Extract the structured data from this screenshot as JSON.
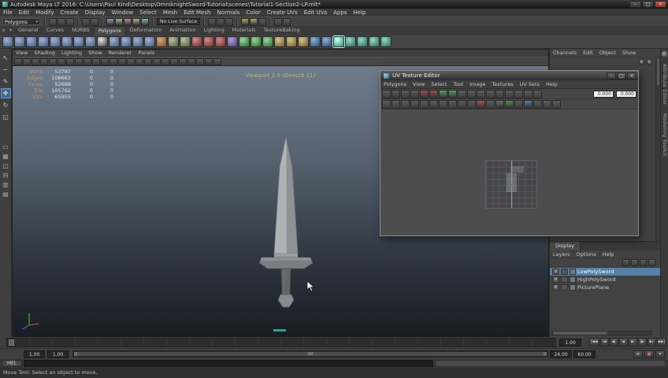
{
  "colors": {
    "selection_blue": "#5580a8",
    "viewport_top": "#6e7b8b",
    "viewport_bottom": "#191d23",
    "hud_label": "#c49a66",
    "viewport_title": "#b9bd6a",
    "close_button": "#c75b50"
  },
  "title_bar": {
    "title": "Autodesk Maya LT 2016: C:\\Users\\Paul Kind\\Desktop\\OmniknightSword-Tutorial\\scenes\\Tutorial1-Section2-LP.mlt*",
    "minimize": "–",
    "maximize": "□",
    "close": "×"
  },
  "menu_bar": {
    "items": [
      "File",
      "Edit",
      "Modify",
      "Create",
      "Display",
      "Window",
      "Select",
      "Mesh",
      "Edit Mesh",
      "Normals",
      "Color",
      "Create UVs",
      "Edit UVs",
      "Apps",
      "Help"
    ]
  },
  "status_line": {
    "menu_set": "Polygons",
    "items": [
      {
        "sep": true
      },
      {
        "n": "new-scene-icon"
      },
      {
        "n": "open-scene-icon"
      },
      {
        "n": "save-scene-icon"
      },
      {
        "sep": true
      },
      {
        "n": "undo-icon"
      },
      {
        "n": "redo-icon"
      },
      {
        "sep": true
      },
      {
        "n": "snap-to-grid-icon",
        "c": "#8a97bb"
      },
      {
        "n": "snap-to-curve-icon",
        "c": "#93b98a"
      },
      {
        "n": "snap-to-point-icon",
        "c": "#bb8a8a"
      },
      {
        "n": "snap-to-view-plane-icon",
        "c": "#b9ae8a"
      },
      {
        "n": "make-live-icon",
        "c": "#8ab9b0"
      },
      {
        "sep": true
      },
      {
        "n": "live-surface-dropdown",
        "label": "No Live Surface"
      },
      {
        "sep": true
      },
      {
        "n": "construction-history-icon"
      },
      {
        "n": "selection-highlight-icon"
      },
      {
        "n": "quick-select-icon"
      },
      {
        "sep": true
      },
      {
        "n": "render-current-frame-icon",
        "c": "#b0a36a"
      },
      {
        "n": "ipr-render-icon",
        "c": "#b0a36a"
      },
      {
        "n": "render-settings-icon"
      },
      {
        "sep": true
      },
      {
        "n": "paint-effects-icon"
      },
      {
        "n": "toolbox-toggle-icon"
      }
    ]
  },
  "shelf": {
    "tabs": [
      "General",
      "Curves",
      "NURBS",
      "Polygons",
      "Deformation",
      "Animation",
      "Lighting",
      "Materials",
      "TextureBaking"
    ],
    "active_tab": "Polygons",
    "icons": [
      {
        "n": "poly-sphere-icon",
        "c1": "#9db4d6",
        "c2": "#40567a"
      },
      {
        "n": "poly-cube-icon",
        "c1": "#9db4d6",
        "c2": "#40567a"
      },
      {
        "n": "poly-cylinder-icon",
        "c1": "#9db4d6",
        "c2": "#40567a"
      },
      {
        "n": "poly-cone-icon",
        "c1": "#9db4d6",
        "c2": "#40567a"
      },
      {
        "n": "poly-torus-icon",
        "c1": "#9db4d6",
        "c2": "#40567a"
      },
      {
        "n": "poly-plane-icon",
        "c1": "#9db4d6",
        "c2": "#40567a"
      },
      {
        "n": "poly-disc-icon",
        "c1": "#9db4d6",
        "c2": "#40567a"
      },
      {
        "n": "poly-gear-icon",
        "c1": "#9db4d6",
        "c2": "#40567a"
      },
      {
        "n": "poly-soccer-ball-icon",
        "c1": "#e8e8e8",
        "c2": "#333333"
      },
      {
        "n": "poly-platonic-icon",
        "c1": "#9db4d6",
        "c2": "#40567a"
      },
      {
        "n": "poly-pyramid-icon",
        "c1": "#9db4d6",
        "c2": "#40567a"
      },
      {
        "n": "poly-pipe-icon",
        "c1": "#9db4d6",
        "c2": "#40567a"
      },
      {
        "n": "poly-helix-icon",
        "c1": "#9db4d6",
        "c2": "#40567a"
      },
      {
        "n": "sculpt-tool-icon",
        "c1": "#d6a77a",
        "c2": "#7a4e28"
      },
      {
        "n": "combine-icon",
        "c1": "#b8c4a0",
        "c2": "#4e5a38"
      },
      {
        "n": "separate-icon",
        "c1": "#b8c4a0",
        "c2": "#4e5a38"
      },
      {
        "n": "boolean-union-icon",
        "c1": "#d68a8a",
        "c2": "#6a2828"
      },
      {
        "n": "boolean-difference-icon",
        "c1": "#d68a8a",
        "c2": "#6a2828"
      },
      {
        "n": "boolean-intersect-icon",
        "c1": "#d68a8a",
        "c2": "#6a2828"
      },
      {
        "n": "smooth-icon",
        "c1": "#b0a0d6",
        "c2": "#4a3a7a"
      },
      {
        "n": "triangulate-icon",
        "c1": "#9ad69a",
        "c2": "#2a6a2a"
      },
      {
        "n": "quadrangulate-icon",
        "c1": "#9ad69a",
        "c2": "#2a6a2a"
      },
      {
        "n": "fill-hole-icon",
        "c1": "#9ad69a",
        "c2": "#2a6a2a"
      },
      {
        "n": "reduce-icon",
        "c1": "#d6c48a",
        "c2": "#6a5a28"
      },
      {
        "n": "extrude-icon",
        "c1": "#d6c48a",
        "c2": "#6a5a28"
      },
      {
        "n": "bevel-icon",
        "c1": "#d6c48a",
        "c2": "#6a5a28"
      },
      {
        "n": "bridge-icon",
        "c1": "#8ab4d6",
        "c2": "#28466a"
      },
      {
        "n": "append-polygon-icon",
        "c1": "#8ab4d6",
        "c2": "#28466a"
      },
      {
        "n": "planar-mapping-icon",
        "c1": "#9ad6c4",
        "c2": "#2a6a5a",
        "active": true
      },
      {
        "n": "automatic-mapping-icon",
        "c1": "#9ad6c4",
        "c2": "#2a6a5a"
      },
      {
        "n": "cylindrical-mapping-icon",
        "c1": "#9ad6c4",
        "c2": "#2a6a5a"
      },
      {
        "n": "spherical-mapping-icon",
        "c1": "#9ad6c4",
        "c2": "#2a6a5a"
      },
      {
        "n": "unfold-icon",
        "c1": "#9ad6c4",
        "c2": "#2a6a5a"
      }
    ]
  },
  "toolbox": {
    "tools": [
      {
        "name": "select-tool",
        "glyph": "↖"
      },
      {
        "name": "lasso-tool",
        "glyph": "∽"
      },
      {
        "name": "paint-selection-tool",
        "glyph": "✎"
      },
      {
        "name": "move-tool",
        "glyph": "✛"
      },
      {
        "name": "rotate-tool",
        "glyph": "↻"
      },
      {
        "name": "scale-tool",
        "glyph": "◱"
      }
    ],
    "active_tool": "move-tool",
    "layout_buttons": [
      {
        "name": "single-pane-layout-button",
        "glyph": "▭"
      },
      {
        "name": "four-pane-layout-button",
        "glyph": "▦"
      },
      {
        "name": "two-pane-side-layout-button",
        "glyph": "◫"
      },
      {
        "name": "two-pane-stacked-layout-button",
        "glyph": "⊟"
      },
      {
        "name": "three-pane-layout-button",
        "glyph": "▥"
      },
      {
        "name": "outliner-persp-layout-button",
        "glyph": "▤"
      }
    ]
  },
  "viewport": {
    "panel_menus": [
      "View",
      "Shading",
      "Lighting",
      "Show",
      "Renderer",
      "Panels"
    ],
    "title": "Viewport 2.0 (DirectX 11)",
    "panel_icons": [
      "select-camera-icon",
      "lock-camera-icon",
      "camera-attributes-icon",
      "bookmarks-icon",
      "image-plane-icon",
      "grid-toggle-icon",
      "film-gate-icon",
      "resolution-gate-icon",
      "gate-mask-icon",
      "field-chart-icon",
      "safe-action-icon",
      "safe-title-icon",
      "wireframe-mode-icon",
      "shaded-mode-icon",
      "textured-mode-icon",
      "use-all-lights-icon",
      "shadows-toggle-icon",
      "ambient-occlusion-icon",
      "motion-blur-icon",
      "anti-aliasing-icon",
      "exposure-icon",
      "gamma-icon",
      "isolate-select-icon",
      "xray-mode-icon"
    ],
    "hud_rows": [
      {
        "label": "Verts:",
        "total": "53787",
        "sel": "0",
        "other": "0"
      },
      {
        "label": "Edges:",
        "total": "106663",
        "sel": "0",
        "other": "0"
      },
      {
        "label": "Faces:",
        "total": "52688",
        "sel": "0",
        "other": "0"
      },
      {
        "label": "Tris:",
        "total": "105762",
        "sel": "0",
        "other": "0"
      },
      {
        "label": "UVs:",
        "total": "65955",
        "sel": "0",
        "other": "0"
      }
    ]
  },
  "uv_editor": {
    "title": "UV Texture Editor",
    "minimize": "–",
    "maximize": "□",
    "close": "×",
    "menus": [
      "Polygons",
      "View",
      "Select",
      "Tool",
      "Image",
      "Textures",
      "UV Sets",
      "Help"
    ],
    "coord_u": "0.000",
    "coord_v": "0.000",
    "toolbar1": [
      {
        "n": "flip-u-icon"
      },
      {
        "n": "flip-v-icon"
      },
      {
        "n": "rotate-ccw-icon"
      },
      {
        "n": "rotate-cw-icon"
      },
      {
        "n": "cut-uv-icon",
        "c": "#a05050"
      },
      {
        "n": "split-uv-icon",
        "c": "#a05050"
      },
      {
        "n": "sew-uv-icon",
        "c": "#50a060"
      },
      {
        "n": "move-and-sew-icon",
        "c": "#50a060"
      },
      {
        "n": "layout-uv-icon"
      },
      {
        "n": "grid-uv-icon"
      },
      {
        "n": "align-u-min-icon"
      },
      {
        "n": "align-u-max-icon"
      },
      {
        "n": "align-v-min-icon"
      },
      {
        "n": "align-v-max-icon"
      },
      {
        "n": "isolate-select-toggle-icon"
      },
      {
        "n": "add-to-isolate-icon"
      },
      {
        "n": "remove-from-isolate-icon"
      }
    ],
    "toolbar2": [
      {
        "n": "uv-lattice-tool-icon"
      },
      {
        "n": "uv-smudge-tool-icon"
      },
      {
        "n": "move-uv-shell-tool-icon"
      },
      {
        "n": "select-shell-icon"
      },
      {
        "n": "uv-snapshot-icon"
      },
      {
        "n": "display-image-toggle-icon"
      },
      {
        "n": "filtered-image-toggle-icon"
      },
      {
        "n": "dim-image-toggle-icon"
      },
      {
        "n": "view-grid-toggle-icon"
      },
      {
        "n": "pixel-snap-icon"
      },
      {
        "n": "shaded-uv-display-icon",
        "c": "#b05050"
      },
      {
        "n": "texture-borders-toggle-icon"
      },
      {
        "n": "checker-display-icon",
        "c": "#6a6a6a"
      },
      {
        "n": "uv-distortion-icon",
        "c": "#5a8a5a"
      },
      {
        "n": "uv-texture-bake-icon"
      },
      {
        "n": "refresh-image-icon",
        "c": "#5a7ab0"
      },
      {
        "n": "uv-sets-menu-icon"
      },
      {
        "n": "copy-uv-icon"
      },
      {
        "n": "paste-uv-icon"
      }
    ]
  },
  "channel_box": {
    "menus": [
      "Channels",
      "Edit",
      "Object",
      "Show"
    ]
  },
  "layer_editor": {
    "tab": "Display",
    "menus": [
      "Layers",
      "Options",
      "Help"
    ],
    "toolbar": [
      "layer-options-icon",
      "transfer-attributes-icon",
      "move-layer-up-icon",
      "new-layer-icon"
    ],
    "layers": [
      {
        "name": "LowPolySword",
        "visibility": "V",
        "selected": true
      },
      {
        "name": "HighPolySword",
        "visibility": "V",
        "selected": false
      },
      {
        "name": "PicturePlane",
        "visibility": "V",
        "selected": false
      }
    ]
  },
  "sidebar": {
    "tabs": [
      "Attribute Editor",
      "Modeling Toolkit"
    ]
  },
  "time_slider": {
    "current_frame": "1.00",
    "playback_buttons": [
      {
        "name": "go-to-start-button",
        "glyph": "|◀◀"
      },
      {
        "name": "step-back-frame-button",
        "glyph": "|◀"
      },
      {
        "name": "step-back-key-button",
        "glyph": "◀|"
      },
      {
        "name": "play-backwards-button",
        "glyph": "◀"
      },
      {
        "name": "play-forwards-button",
        "glyph": "▶"
      },
      {
        "name": "step-forward-key-button",
        "glyph": "|▶"
      },
      {
        "name": "step-forward-frame-button",
        "glyph": "▶|"
      },
      {
        "name": "go-to-end-button",
        "glyph": "▶▶|"
      }
    ]
  },
  "range_slider": {
    "anim_start": "1.00",
    "playback_start": "1.00",
    "bar_label": "20",
    "playback_end": "24.00",
    "anim_end": "60.00",
    "buttons": [
      {
        "name": "character-set-menu-button",
        "glyph": "≡"
      },
      {
        "name": "auto-keyframe-toggle",
        "glyph": "●",
        "cls": "autokey"
      },
      {
        "name": "animation-preferences-button",
        "glyph": "▾"
      }
    ]
  },
  "command_line": {
    "label": "MEL"
  },
  "help_line": {
    "text": "Move Tool: Select an object to move."
  }
}
